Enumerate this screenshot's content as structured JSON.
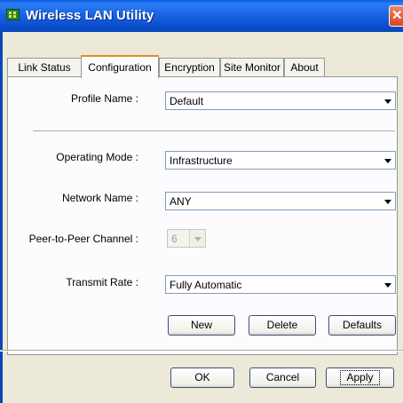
{
  "window": {
    "title": "Wireless LAN Utility"
  },
  "tabs": [
    {
      "label": "Link Status"
    },
    {
      "label": "Configuration"
    },
    {
      "label": "Encryption"
    },
    {
      "label": "Site Monitor"
    },
    {
      "label": "About"
    }
  ],
  "active_tab": "Configuration",
  "form": {
    "profile_name": {
      "label": "Profile Name :",
      "value": "Default"
    },
    "operating_mode": {
      "label": "Operating Mode :",
      "value": "Infrastructure"
    },
    "network_name": {
      "label": "Network Name :",
      "value": "ANY"
    },
    "peer_channel": {
      "label": "Peer-to-Peer Channel :",
      "value": "6"
    },
    "transmit_rate": {
      "label": "Transmit Rate :",
      "value": "Fully Automatic"
    }
  },
  "profile_buttons": {
    "new": "New",
    "delete": "Delete",
    "defaults": "Defaults"
  },
  "dialog_buttons": {
    "ok": "OK",
    "cancel": "Cancel",
    "apply": "Apply"
  },
  "colors": {
    "titlebar": "#0a5fe0",
    "active_tab_accent": "#e68b2c",
    "dialog_bg": "#ece9d8"
  }
}
